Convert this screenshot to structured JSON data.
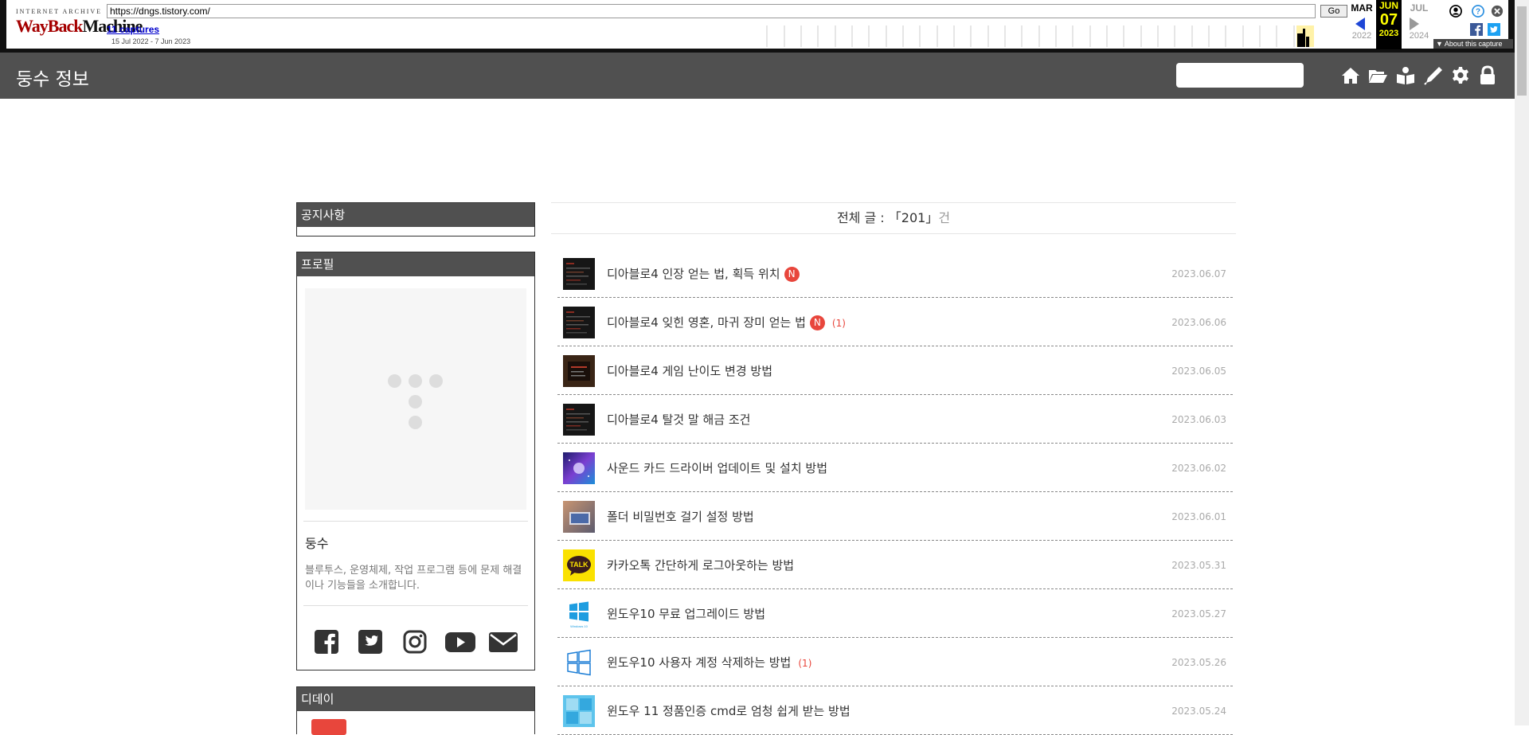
{
  "wayback": {
    "logo_top": "INTERNET ARCHIVE",
    "logo_way": "WayBack",
    "logo_machine": "Machine",
    "url": "https://dngs.tistory.com/",
    "go": "Go",
    "captures": "11 captures",
    "range": "15 Jul 2022 - 7 Jun 2023",
    "prev_month": "MAR",
    "prev_year": "2022",
    "cur_month": "JUN",
    "cur_day": "07",
    "cur_year": "2023",
    "next_month": "JUL",
    "next_year": "2024",
    "about": "About this capture"
  },
  "header": {
    "title": "둥수 정보",
    "search_placeholder": ""
  },
  "sidebar": {
    "notice_title": "공지사항",
    "profile_title": "프로필",
    "profile_name": "둥수",
    "profile_desc": "블루투스, 운영체제, 작업 프로그램 등에 문제 해결이나 기능들을 소개합니다.",
    "dday_title": "디데이"
  },
  "main": {
    "heading_prefix": "전체 글 : ",
    "heading_count": "「201」",
    "heading_suffix": "건",
    "posts": [
      {
        "title": "디아블로4 인장 얻는 법, 획득 위치",
        "new": "N",
        "comments": "",
        "date": "2023.06.07",
        "thumb": "dark"
      },
      {
        "title": "디아블로4 잊힌 영혼, 마귀 장미 얻는 법",
        "new": "N",
        "comments": "(1)",
        "date": "2023.06.06",
        "thumb": "dark"
      },
      {
        "title": "디아블로4 게임 난이도 변경 방법",
        "new": "",
        "comments": "",
        "date": "2023.06.05",
        "thumb": "dark-red"
      },
      {
        "title": "디아블로4 탈것 말 해금 조건",
        "new": "",
        "comments": "",
        "date": "2023.06.03",
        "thumb": "dark"
      },
      {
        "title": "사운드 카드 드라이버 업데이트 및 설치 방법",
        "new": "",
        "comments": "",
        "date": "2023.06.02",
        "thumb": "space"
      },
      {
        "title": "폴더 비밀번호 걸기 설정 방법",
        "new": "",
        "comments": "",
        "date": "2023.06.01",
        "thumb": "laptop"
      },
      {
        "title": "카카오톡 간단하게 로그아웃하는 방법",
        "new": "",
        "comments": "",
        "date": "2023.05.31",
        "thumb": "talk"
      },
      {
        "title": "윈도우10 무료 업그레이드 방법",
        "new": "",
        "comments": "",
        "date": "2023.05.27",
        "thumb": "windows"
      },
      {
        "title": "윈도우10 사용자 계정 삭제하는 방법",
        "new": "",
        "comments": "(1)",
        "date": "2023.05.26",
        "thumb": "winoutline"
      },
      {
        "title": "윈도우 11 정품인증 cmd로 엄청 쉽게 받는 방법",
        "new": "",
        "comments": "",
        "date": "2023.05.24",
        "thumb": "win11"
      }
    ]
  },
  "thumb_text": {
    "talk": "TALK",
    "windows": "Windows 10"
  },
  "colors": {
    "header_bg": "#505050",
    "new_badge": "#e8463c",
    "comment": "#e8463c",
    "wayback_red": "#a50000"
  }
}
